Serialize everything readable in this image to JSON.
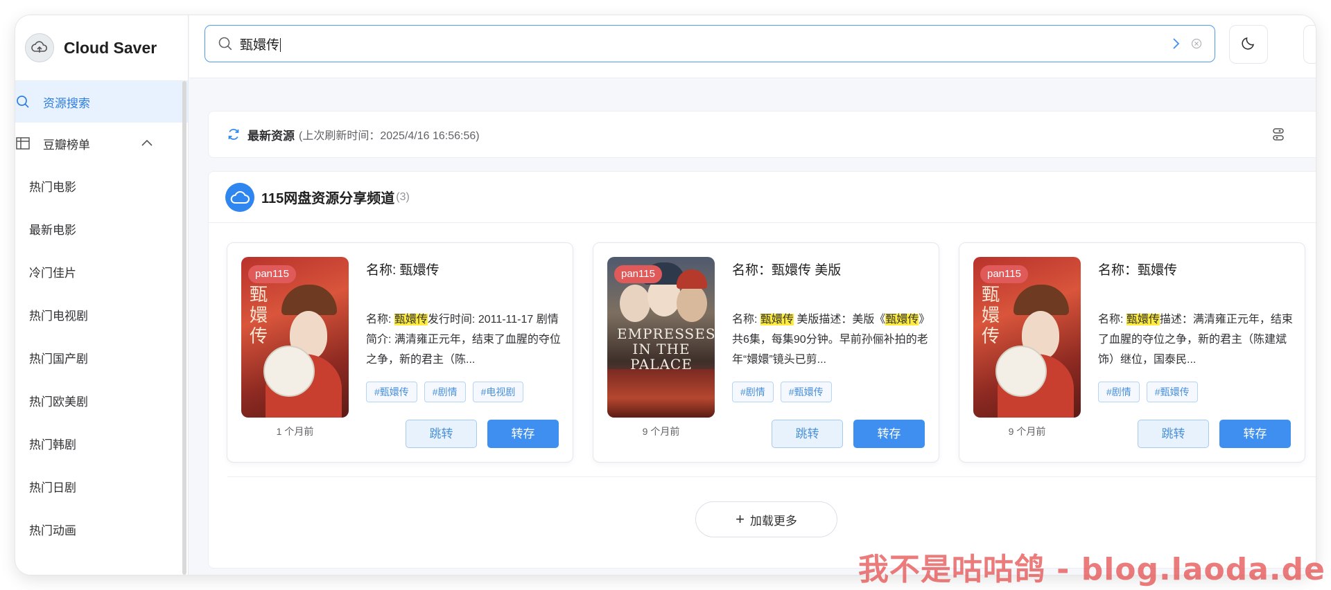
{
  "app": {
    "name": "Cloud Saver",
    "logo_icon": "cloud-upload-icon"
  },
  "sidebar": {
    "search_label": "资源搜索",
    "douban_label": "豆瓣榜单",
    "sub_items": [
      "热门电影",
      "最新电影",
      "冷门佳片",
      "热门电视剧",
      "热门国产剧",
      "热门欧美剧",
      "热门韩剧",
      "热门日剧",
      "热门动画"
    ]
  },
  "search": {
    "value": "甄嬛传"
  },
  "latest": {
    "title": "最新资源",
    "subtitle": "(上次刷新时间：2025/4/16 16:56:56)"
  },
  "channel": {
    "name": "115网盘资源分享频道",
    "count": "(3)",
    "cards": [
      {
        "tag": "pan115",
        "time": "1 个月前",
        "title": "名称: 甄嬛传",
        "desc_pre": "名称: ",
        "desc_hl": "甄嬛传",
        "desc_post": "发行时间: 2011-11-17 剧情简介: 满清雍正元年，结束了血腥的夺位之争，新的君主（陈...",
        "tags": [
          "#甄嬛传",
          "#剧情",
          "#电视剧"
        ],
        "jump": "跳转",
        "save": "转存",
        "poster_text": "甄嬛传"
      },
      {
        "tag": "pan115",
        "time": "9 个月前",
        "title": "名称：甄嬛传 美版",
        "desc_pre": "名称: ",
        "desc_hl": "甄嬛传",
        "desc_mid": " 美版描述：美版《",
        "desc_hl2": "甄嬛传",
        "desc_post": "》共6集，每集90分钟。早前孙俪补拍的老年“嬛嬛”镜头已剪...",
        "tags": [
          "#剧情",
          "#甄嬛传"
        ],
        "jump": "跳转",
        "save": "转存",
        "poster_text": "EMPRESSES IN THE PALACE"
      },
      {
        "tag": "pan115",
        "time": "9 个月前",
        "title": "名称：甄嬛传",
        "desc_pre": "名称: ",
        "desc_hl": "甄嬛传",
        "desc_post": "描述：满清雍正元年，结束了血腥的夺位之争，新的君主（陈建斌 饰）继位，国泰民...",
        "tags": [
          "#剧情",
          "#甄嬛传"
        ],
        "jump": "跳转",
        "save": "转存",
        "poster_text": "甄嬛传"
      }
    ]
  },
  "load_more": "加载更多",
  "watermark": "我不是咕咕鸽 - blog.laoda.de",
  "colors": {
    "accent": "#3f8ff0",
    "highlight": "#ffec3d",
    "tag_red": "#e05a5a"
  }
}
